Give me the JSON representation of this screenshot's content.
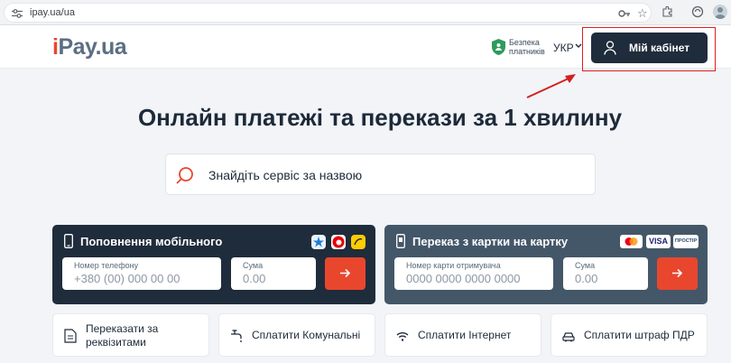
{
  "browser": {
    "url": "ipay.ua/ua"
  },
  "header": {
    "logo_i": "i",
    "logo_rest": "Pay.ua",
    "security_line1": "Безпека",
    "security_line2": "платників",
    "language": "УКР",
    "cabinet_button": "Мій кабінет"
  },
  "hero": {
    "title": "Онлайн платежі та перекази за 1 хвилину",
    "search_placeholder": "Знайдіть сервіс за назвою"
  },
  "mobile_card": {
    "title": "Поповнення мобільного",
    "operators": [
      "kyivstar-icon",
      "vodafone-icon",
      "lifecell-icon"
    ],
    "phone_label": "Номер телефону",
    "phone_placeholder": "+380 (00) 000 00 00",
    "amount_label": "Сума",
    "amount_placeholder": "0.00"
  },
  "transfer_card": {
    "title": "Переказ з картки на картку",
    "payment_systems": [
      "mastercard-icon",
      "VISA",
      "ПРОСТІР"
    ],
    "card_label": "Номер карти отримувача",
    "card_placeholder": "0000 0000 0000 0000",
    "amount_label": "Сума",
    "amount_placeholder": "0.00"
  },
  "services": [
    {
      "line1": "Переказати за",
      "line2": "реквізитами"
    },
    {
      "line1": "Сплатити Комунальні"
    },
    {
      "line1": "Сплатити Інтернет"
    },
    {
      "line1": "Сплатити штраф ПДР"
    }
  ],
  "colors": {
    "accent": "#e8472e",
    "dark_card": "#1f2c3b",
    "slate_card": "#435769",
    "page_bg": "#f2f4f7",
    "highlight_frame": "#e01e1e"
  }
}
